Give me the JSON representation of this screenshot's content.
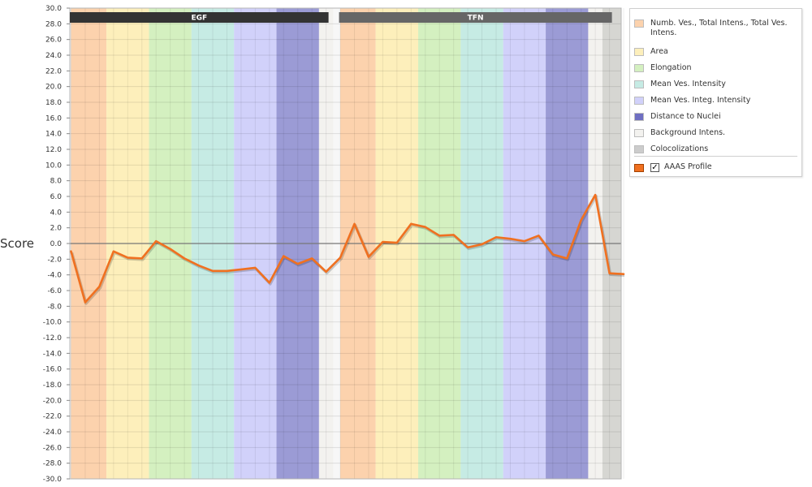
{
  "chart_data": {
    "type": "line",
    "ylabel": "Score",
    "ylim": [
      -30,
      30
    ],
    "ytick_step": 2,
    "yticks": [
      "30.0",
      "28.0",
      "26.0",
      "24.0",
      "22.0",
      "20.0",
      "18.0",
      "16.0",
      "14.0",
      "12.0",
      "10.0",
      "8.0",
      "6.0",
      "4.0",
      "2.0",
      "0.0",
      "-2.0",
      "-4.0",
      "-6.0",
      "-8.0",
      "-10.0",
      "-12.0",
      "-14.0",
      "-16.0",
      "-18.0",
      "-20.0",
      "-22.0",
      "-24.0",
      "-26.0",
      "-28.0",
      "-30.0"
    ],
    "grid": true,
    "point_count": 40,
    "groups": [
      {
        "label": "EGF",
        "start": 0,
        "end": 18,
        "color": "#333333"
      },
      {
        "label": "TFN",
        "start": 19,
        "end": 38,
        "color": "#666666"
      }
    ],
    "feature_bands": [
      {
        "category": "Numb. Ves., Total Intens., Total Ves. Intens.",
        "color": "#fcd2ad",
        "segments": [
          [
            0,
            2.5
          ],
          [
            19,
            21.5
          ]
        ]
      },
      {
        "category": "Area",
        "color": "#fdefbb",
        "segments": [
          [
            2.5,
            5.5
          ],
          [
            21.5,
            24.5
          ]
        ]
      },
      {
        "category": "Elongation",
        "color": "#d4f0c0",
        "segments": [
          [
            5.5,
            8.5
          ],
          [
            24.5,
            27.5
          ]
        ]
      },
      {
        "category": "Mean Ves. Intensity",
        "color": "#c6ebe4",
        "segments": [
          [
            8.5,
            11.5
          ],
          [
            27.5,
            30.5
          ]
        ]
      },
      {
        "category": "Mean Ves. Integ. Intensity",
        "color": "#d1d1fa",
        "segments": [
          [
            11.5,
            14.5
          ],
          [
            30.5,
            33.5
          ]
        ]
      },
      {
        "category": "Distance to Nuclei",
        "color": "#9b9bd5",
        "segments": [
          [
            14.5,
            17.5
          ],
          [
            33.5,
            36.5
          ]
        ]
      },
      {
        "category": "Background Intens.",
        "color": "#f3f2ef",
        "segments": [
          [
            17.5,
            18.5
          ],
          [
            36.5,
            37.5
          ]
        ]
      },
      {
        "category": "Colocolizations",
        "color": "#d6d6d2",
        "segments": [
          [
            37.5,
            39
          ]
        ]
      }
    ],
    "series": [
      {
        "name": "AAAS Profile",
        "color": "#f07020",
        "values": [
          -1.0,
          -7.5,
          -5.5,
          -1.0,
          -1.8,
          -1.9,
          0.3,
          -0.7,
          -1.9,
          -2.8,
          -3.5,
          -3.5,
          -3.3,
          -3.1,
          -5.0,
          -1.6,
          -2.6,
          -1.9,
          -3.6,
          -1.8,
          2.5,
          -1.7,
          0.2,
          0.1,
          2.5,
          2.1,
          1.0,
          1.1,
          -0.5,
          -0.1,
          0.8,
          0.6,
          0.3,
          1.0,
          -1.4,
          -1.9,
          3.0,
          6.2,
          -3.8,
          -3.9
        ]
      }
    ]
  },
  "legend": {
    "items": [
      {
        "label": "Numb. Ves., Total Intens., Total Ves. Intens.",
        "color": "#fcd2ad"
      },
      {
        "label": "Area",
        "color": "#fdefbb"
      },
      {
        "label": "Elongation",
        "color": "#d4f0c0"
      },
      {
        "label": "Mean Ves. Intensity",
        "color": "#c6ebe4"
      },
      {
        "label": "Mean Ves. Integ. Intensity",
        "color": "#d1d1fa"
      },
      {
        "label": "Distance to Nuclei",
        "color": "#6f6fc2"
      },
      {
        "label": "Background Intens.",
        "color": "#f3f2ef"
      },
      {
        "label": "Colocolizations",
        "color": "#cccccc"
      }
    ],
    "profile": {
      "label": "AAAS Profile",
      "color": "#f07020",
      "checked": true,
      "check_mark": "✓"
    }
  }
}
